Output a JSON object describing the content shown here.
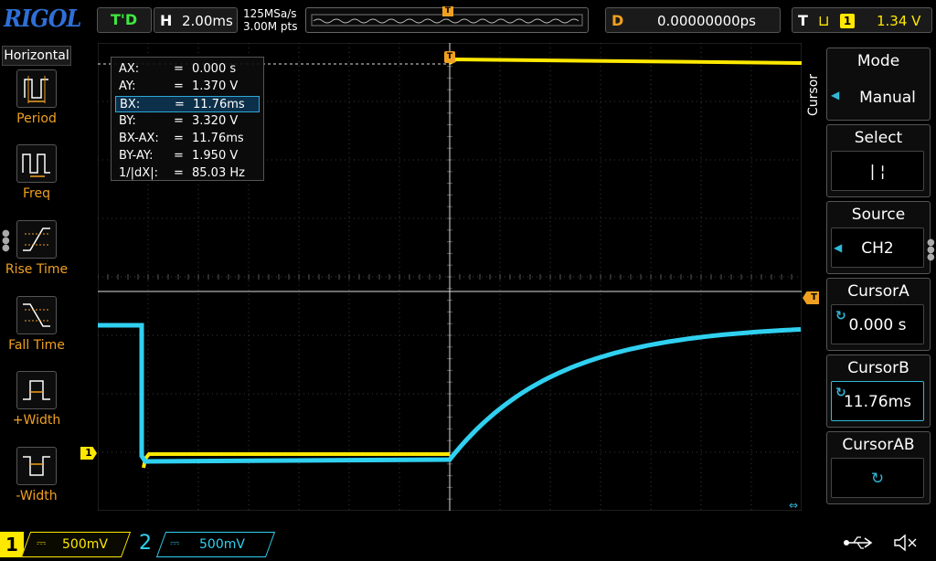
{
  "brand": "RIGOL",
  "top": {
    "run_state": "T'D",
    "timebase_label": "H",
    "timebase_value": "2.00ms",
    "sample_rate": "125MSa/s",
    "memory_depth": "3.00M pts",
    "trigger_marker": "T",
    "delay_label": "D",
    "delay_value": "0.00000000ps",
    "trigger_label": "T",
    "trigger_edge": "⊔",
    "trigger_source": "1",
    "trigger_level": "1.34 V"
  },
  "left_panel": {
    "title": "Horizontal",
    "items": [
      {
        "label": "Period",
        "icon": "period-icon"
      },
      {
        "label": "Freq",
        "icon": "freq-icon"
      },
      {
        "label": "Rise Time",
        "icon": "rise-time-icon"
      },
      {
        "label": "Fall Time",
        "icon": "fall-time-icon"
      },
      {
        "label": "+Width",
        "icon": "pos-width-icon"
      },
      {
        "label": "-Width",
        "icon": "neg-width-icon"
      }
    ]
  },
  "readout": {
    "rows": [
      {
        "key": "AX:",
        "eq": "=",
        "value": "0.000 s",
        "selected": false
      },
      {
        "key": "AY:",
        "eq": "=",
        "value": "1.370 V",
        "selected": false
      },
      {
        "key": "BX:",
        "eq": "=",
        "value": "11.76ms",
        "selected": true
      },
      {
        "key": "BY:",
        "eq": "=",
        "value": "3.320 V",
        "selected": false
      },
      {
        "key": "BX-AX:",
        "eq": "=",
        "value": "11.76ms",
        "selected": false
      },
      {
        "key": "BY-AY:",
        "eq": "=",
        "value": "1.950 V",
        "selected": false
      },
      {
        "key": "1/|dX|:",
        "eq": "=",
        "value": "85.03 Hz",
        "selected": false
      }
    ]
  },
  "markers": {
    "ch1": "1",
    "trigger_level": "T"
  },
  "right_panel": {
    "menu_title": "Cursor",
    "mode": {
      "title": "Mode",
      "value": "Manual"
    },
    "select": {
      "title": "Select",
      "value": "|    ¦"
    },
    "source": {
      "title": "Source",
      "value": "CH2"
    },
    "cursor_a": {
      "title": "CursorA",
      "value": "0.000 s"
    },
    "cursor_b": {
      "title": "CursorB",
      "value": "11.76ms"
    },
    "cursor_ab": {
      "title": "CursorAB",
      "value": "↻"
    }
  },
  "bottom": {
    "ch1_num": "1",
    "ch1_coupling": "⎓",
    "ch1_scale": "500mV",
    "ch2_num": "2",
    "ch2_coupling": "⎓",
    "ch2_scale": "500mV",
    "usb": "⭠",
    "speaker": "🔇"
  },
  "colors": {
    "ch1": "#ffe800",
    "ch2": "#30d0f0",
    "accent": "#f0a020",
    "grid": "#3a3a3a"
  }
}
